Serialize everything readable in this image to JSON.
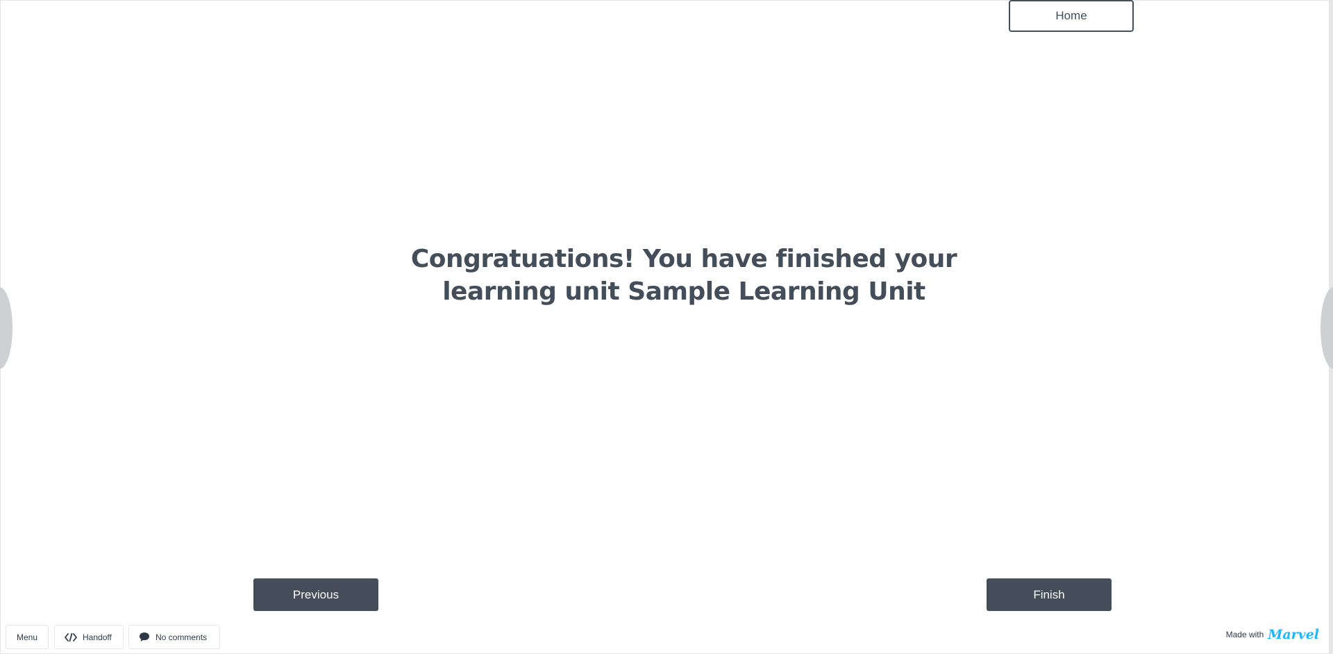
{
  "header": {
    "home_label": "Home"
  },
  "main": {
    "headline_line1": "Congratuations! You have finished your",
    "headline_line2": "learning unit Sample Learning Unit"
  },
  "navigation": {
    "previous_label": "Previous",
    "finish_label": "Finish"
  },
  "toolbar": {
    "menu_label": "Menu",
    "handoff_label": "Handoff",
    "comments_label": "No comments",
    "made_with_label": "Made with",
    "brand_name": "Marvel"
  },
  "icons": {
    "handoff": "code-icon",
    "comments": "comment-bubble-icon"
  },
  "colors": {
    "primary_dark": "#434e5a",
    "brand_blue": "#1fb6ff",
    "background": "#ffffff"
  }
}
